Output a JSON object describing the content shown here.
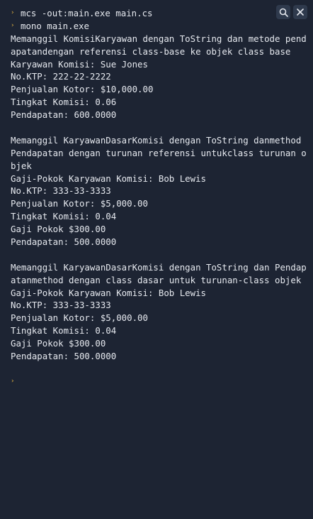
{
  "commands": [
    {
      "prompt": "›",
      "text": "mcs -out:main.exe main.cs"
    },
    {
      "prompt": "›",
      "text": "mono main.exe"
    }
  ],
  "output": [
    "Memanggil KomisiKaryawan dengan ToString dan metode pend",
    "apatandengan referensi class-base ke objek class base",
    "Karyawan Komisi: Sue Jones",
    "No.KTP: 222-22-2222",
    "Penjualan Kotor: $10,000.00",
    "Tingkat Komisi: 0.06",
    "Pendapatan: 600.0000",
    "",
    "Memanggil KaryawanDasarKomisi dengan ToString danmethod",
    "Pendapatan dengan turunan referensi untukclass turunan o",
    "bjek",
    "Gaji-Pokok Karyawan Komisi: Bob Lewis",
    "No.KTP: 333-33-3333",
    "Penjualan Kotor: $5,000.00",
    "Tingkat Komisi: 0.04",
    "Gaji Pokok $300.00",
    "Pendapatan: 500.0000",
    "",
    "Memanggil KaryawanDasarKomisi dengan ToString dan Pendap",
    "atanmethod dengan class dasar untuk turunan-class objek",
    "Gaji-Pokok Karyawan Komisi: Bob Lewis",
    "No.KTP: 333-33-3333",
    "Penjualan Kotor: $5,000.00",
    "Tingkat Komisi: 0.04",
    "Gaji Pokok $300.00",
    "Pendapatan: 500.0000",
    ""
  ],
  "final_prompt": "›",
  "toolbar": {
    "search_icon": "search-icon",
    "close_icon": "close-icon"
  },
  "colors": {
    "background": "#1d2433",
    "text": "#e6e9ef",
    "prompt": "#e3b341",
    "button_bg": "#2f3a4d"
  }
}
